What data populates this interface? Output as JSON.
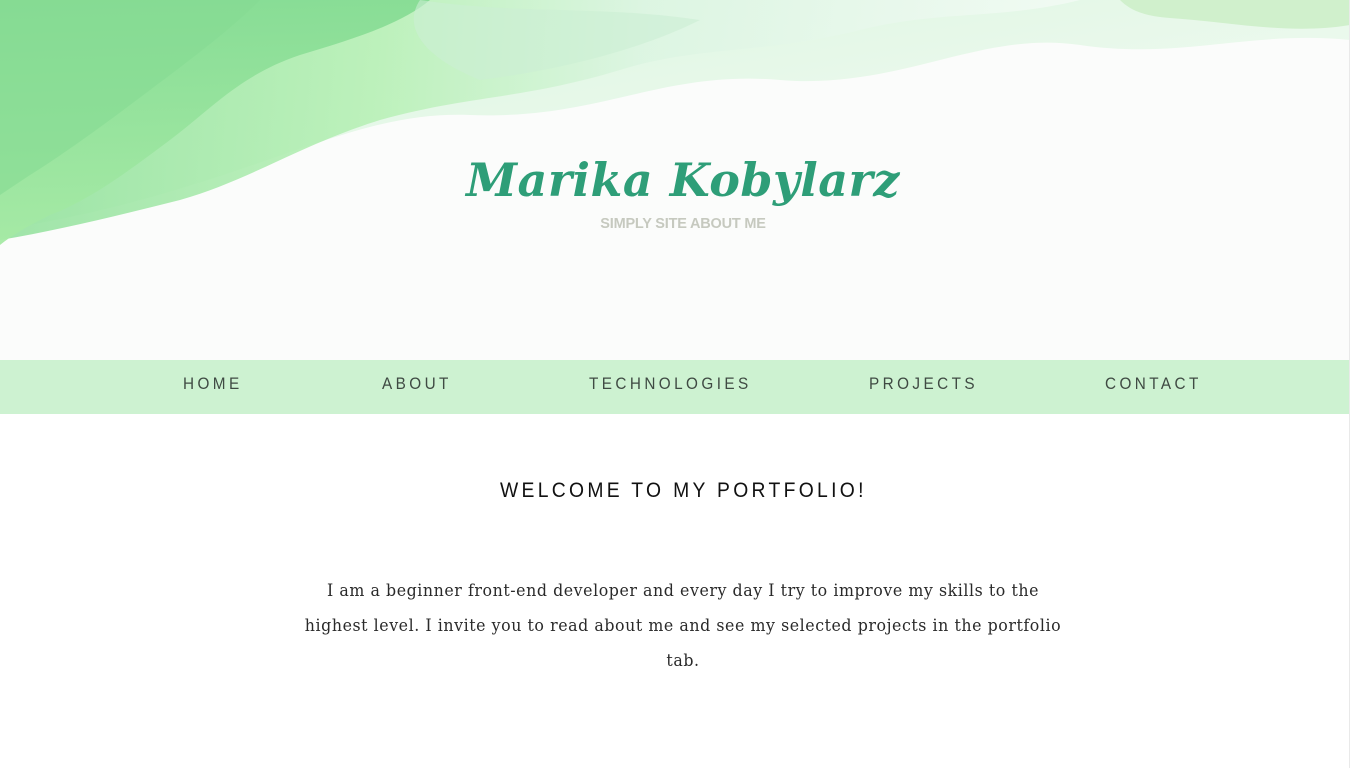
{
  "header": {
    "name": "Marika Kobylarz",
    "tagline": "SIMPLY SITE ABOUT ME"
  },
  "nav": {
    "items": [
      {
        "label": "HOME"
      },
      {
        "label": "ABOUT"
      },
      {
        "label": "TECHNOLOGIES"
      },
      {
        "label": "PROJECTS"
      },
      {
        "label": "CONTACT"
      }
    ]
  },
  "main": {
    "heading": "WELCOME TO MY PORTFOLIO!",
    "intro": "I am a beginner front-end developer and every day I try to improve my skills to the highest level. I invite you to read about me and see my selected projects in the portfolio tab."
  },
  "colors": {
    "accent": "#2e9e78",
    "nav_background": "#cdf2d1",
    "tagline": "#c6c9bf"
  }
}
